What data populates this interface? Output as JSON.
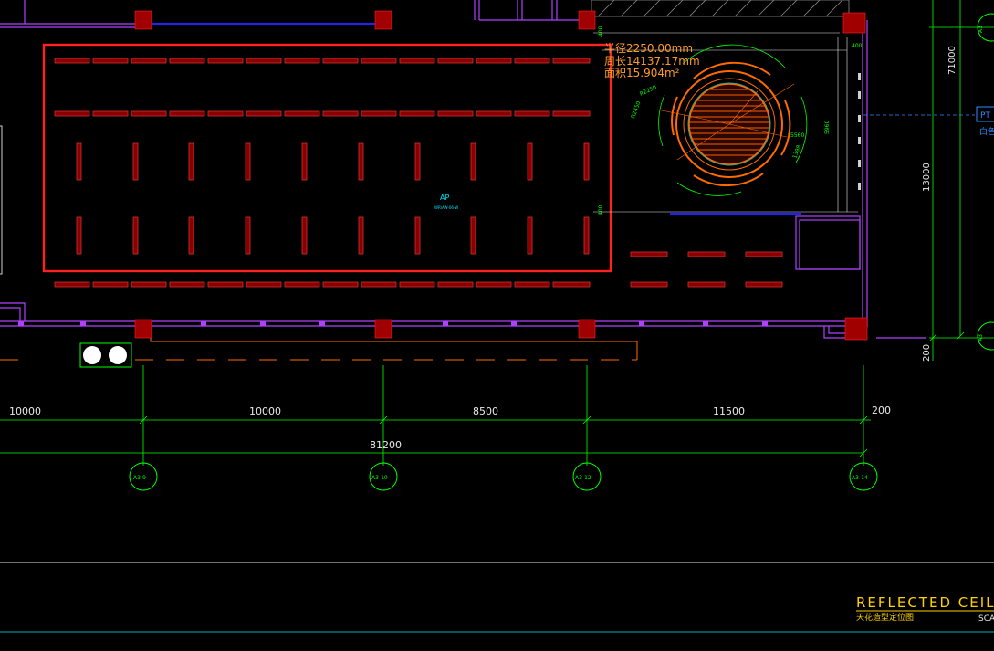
{
  "plan": {
    "annotation": {
      "radius": "半径2250.00mm",
      "perimeter": "周长14137.17mm",
      "area": "面积15.904m²"
    },
    "ap_label": "AP",
    "ap_sub": "WR\\AW-06-W",
    "pt_label": "PT",
    "pt_sub": "白色",
    "title": "REFLECTED CEILIN",
    "subtitle": "天花造型定位图",
    "scale": "SCA",
    "bottom_dims": [
      "10000",
      "10000",
      "8500",
      "11500",
      "200"
    ],
    "total_dim": "81200",
    "side_dims": [
      "71000",
      "13000",
      "200"
    ],
    "grid_labels": [
      "A3-9",
      "A3-10",
      "A3-12",
      "A3-14"
    ],
    "right_labels": [
      "A3",
      "A3"
    ],
    "small_dims": [
      "400",
      "400",
      "R2250",
      "R2450",
      "5560",
      "5960",
      "1398",
      "400"
    ]
  },
  "colors": {
    "background": "#000000",
    "wall": "#b040ff",
    "column": "#a00000",
    "light_fixture": "#c02020",
    "outline_red": "#ff2020",
    "dimension": "#00ff00",
    "circle_orange": "#ff6a00",
    "accent_blue": "#2020ff",
    "title": "#ffd000"
  }
}
